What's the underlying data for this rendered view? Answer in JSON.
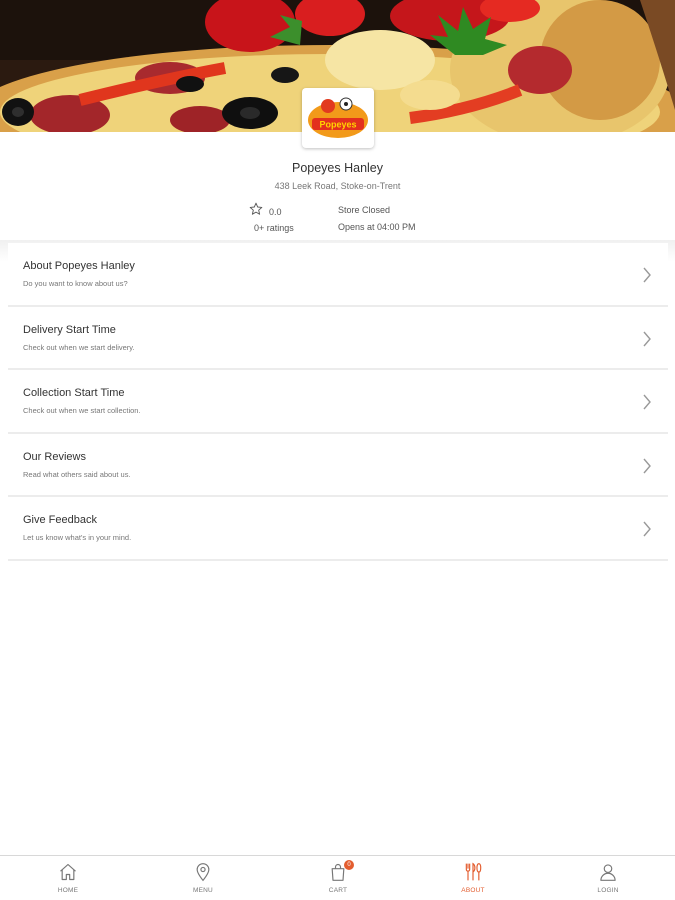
{
  "store": {
    "name": "Popeyes Hanley",
    "address": "438 Leek Road, Stoke-on-Trent",
    "rating": "0.0",
    "rating_count": "0+ ratings",
    "status": "Store Closed",
    "opens": "Opens at 04:00 PM",
    "logo_alt": "Popeyes"
  },
  "menu_items": [
    {
      "title": "About Popeyes Hanley",
      "subtitle": "Do you want to know about us?"
    },
    {
      "title": "Delivery Start Time",
      "subtitle": "Check out when we start delivery."
    },
    {
      "title": "Collection Start Time",
      "subtitle": "Check out when we start collection."
    },
    {
      "title": "Our Reviews",
      "subtitle": "Read what others said about us."
    },
    {
      "title": "Give Feedback",
      "subtitle": "Let us know what's in your mind."
    }
  ],
  "nav": {
    "items": [
      {
        "label": "HOME",
        "icon": "home-icon"
      },
      {
        "label": "MENU",
        "icon": "location-pin-icon"
      },
      {
        "label": "CART",
        "icon": "bag-icon",
        "badge": "0"
      },
      {
        "label": "ABOUT",
        "icon": "cutlery-icon",
        "active": true
      },
      {
        "label": "LOGIN",
        "icon": "user-icon"
      }
    ]
  },
  "colors": {
    "accent": "#e35d2f",
    "divider": "#ececec",
    "text_primary": "#333333",
    "text_secondary": "#777777"
  }
}
